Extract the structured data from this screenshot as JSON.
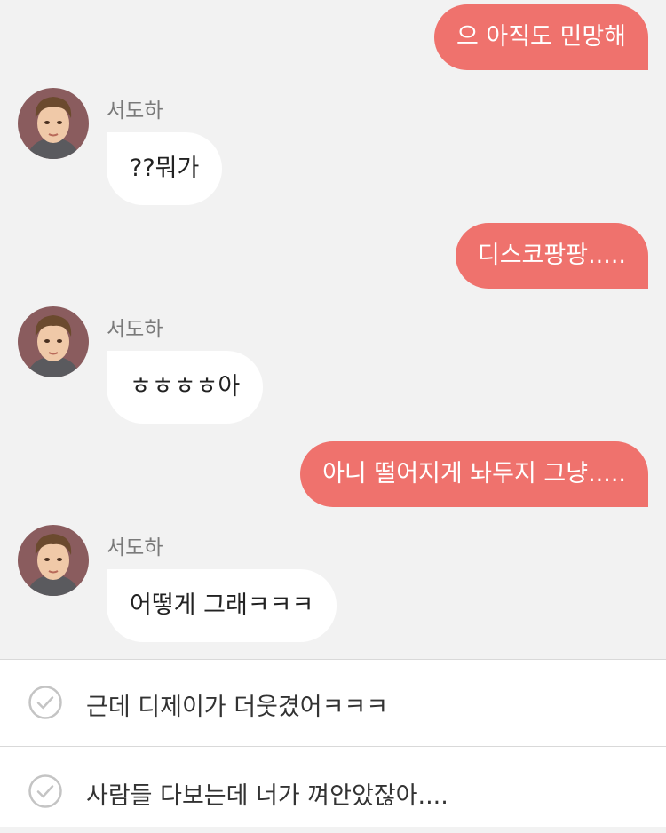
{
  "messages": [
    {
      "type": "out",
      "text": "으 아직도 민망해"
    },
    {
      "type": "in",
      "sender": "서도하",
      "text": "??뭐가"
    },
    {
      "type": "out",
      "text": "디스코팡팡....."
    },
    {
      "type": "in",
      "sender": "서도하",
      "text": "ㅎㅎㅎㅎ아"
    },
    {
      "type": "out",
      "text": "아니 떨어지게 놔두지 그냥....."
    },
    {
      "type": "in",
      "sender": "서도하",
      "text": "어떻게 그래ㅋㅋㅋ"
    }
  ],
  "reply_options": [
    {
      "text": "근데 디제이가 더웃겼어ㅋㅋㅋ"
    },
    {
      "text": "사람들 다보는데 너가 껴안았잖아...."
    }
  ],
  "colors": {
    "outgoing_bubble": "#ef726d",
    "incoming_bubble": "#ffffff",
    "chat_background": "#f2f2f2"
  }
}
